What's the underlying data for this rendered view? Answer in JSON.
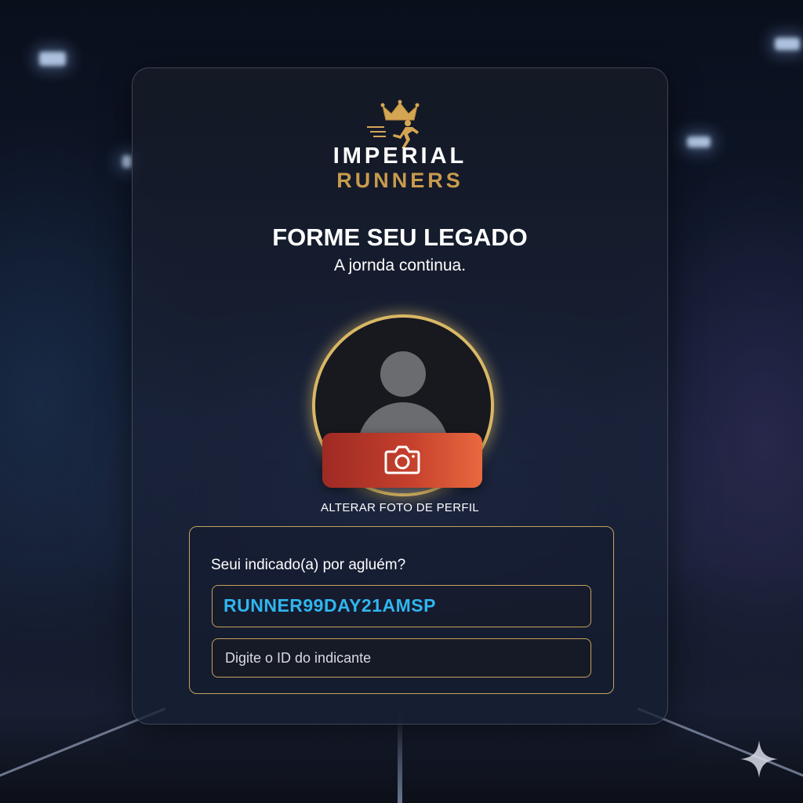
{
  "logo": {
    "line1": "IMPERIAL",
    "line2": "RUNNERS",
    "icon": "crowned-runner-icon"
  },
  "header": {
    "title": "FORME SEU LEGADO",
    "subtitle": "A jornda continua."
  },
  "profile": {
    "avatar_icon": "user-silhouette-icon",
    "camera_icon": "camera-icon",
    "change_photo_label": "ALTERAR FOTO DE PERFIL"
  },
  "referral": {
    "question": "Seui indicado(a) por agluém?",
    "code_value": "RUNNER99DAY21AMSP",
    "id_placeholder": "Digite o ID do indicante"
  },
  "colors": {
    "gold": "#c89b4c",
    "accent_blue": "#2fb6f0",
    "button_red": "#c5402c"
  }
}
